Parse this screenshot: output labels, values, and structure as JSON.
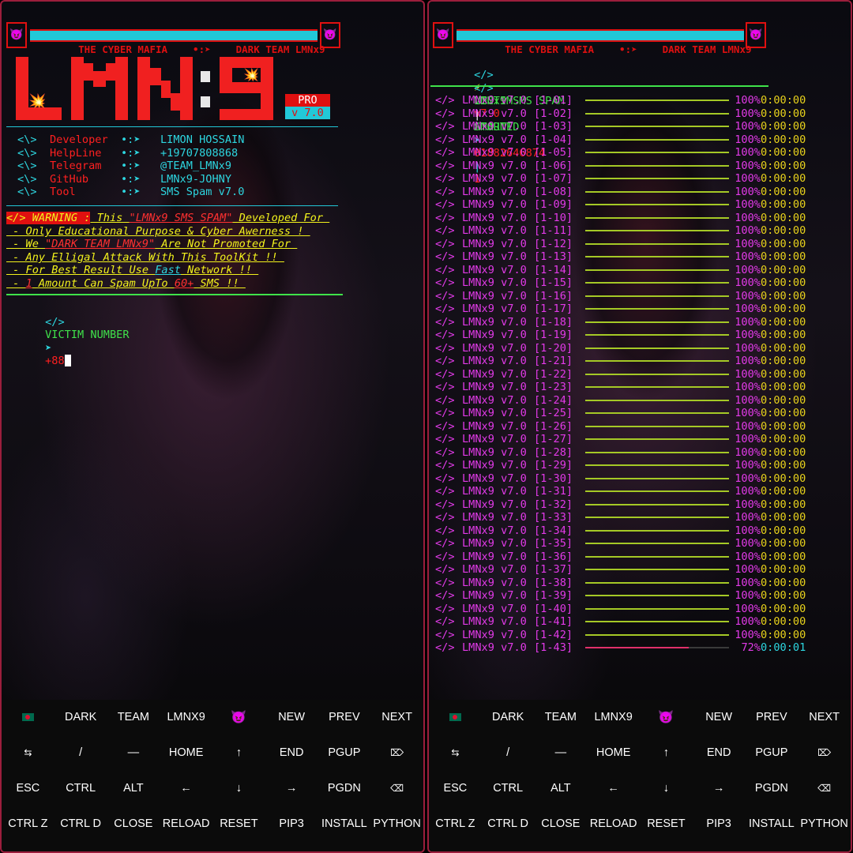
{
  "banner": {
    "left": "THE CYBER MAFIA",
    "arrow": "•:➤",
    "right": "DARK TEAM LMNx9",
    "icon": "😈"
  },
  "logo": {
    "text": "LMN:9",
    "pro": "PRO",
    "version": "v 7.0"
  },
  "info": [
    {
      "icon": "<\\>",
      "label": "Developer",
      "sep": "•:➤",
      "value": "LIMON HOSSAIN"
    },
    {
      "icon": "<\\>",
      "label": "HelpLine",
      "sep": "•:➤",
      "value": "+19707808868"
    },
    {
      "icon": "<\\>",
      "label": "Telegram",
      "sep": "•:➤",
      "value": "@TEAM_LMNx9"
    },
    {
      "icon": "<\\>",
      "label": "GitHub",
      "sep": "•:➤",
      "value": "LMNx9-JOHNY"
    },
    {
      "icon": "<\\>",
      "label": "Tool",
      "sep": "•:➤",
      "value": "SMS Spam v7.0"
    }
  ],
  "warning": {
    "tag": "</> WARNING :",
    "l1a": " This ",
    "l1b": "\"LMNx9 SMS SPAM\"",
    "l1c": " Developed For ",
    "l2": " - Only Educational Purpose & Cyber Awerness ! ",
    "l3a": " - We ",
    "l3b": "\"DARK TEAM LMNx9\"",
    "l3c": " Are Not Promoted For ",
    "l4": " - Any Elligal Attack With This ToolKit !! ",
    "l5a": " - For Best Result Use ",
    "l5b": "Fast",
    "l5c": " Network !! ",
    "l6a": " - ",
    "l6b": "1",
    "l6c": " Amount Can Spam UpTo ",
    "l6d": "60+",
    "l6e": " SMS !! "
  },
  "prompt": {
    "tag": "</>",
    "label": "VICTIM NUMBER",
    "arrow": "➤",
    "value": "+88"
  },
  "status": {
    "tag": "</>",
    "bolt": "⚡",
    "started_a": "LMNx9 SMS SPAM",
    "started_b": "v7.0",
    "started_c": "STARTED",
    "victim": "VICTIM",
    "pipe": "|",
    "amount": "AMOUNT",
    "arrow": "➤",
    "number": "01882646874",
    "count": "1"
  },
  "progress_rows": [
    {
      "tag": "</>",
      "name": "LMNx9 v7.0",
      "id": "[1-01]",
      "percent": "100%",
      "fill": 1.0,
      "time": "0:00:00"
    },
    {
      "tag": "</>",
      "name": "LMNx9 v7.0",
      "id": "[1-02]",
      "percent": "100%",
      "fill": 1.0,
      "time": "0:00:00"
    },
    {
      "tag": "</>",
      "name": "LMNx9 v7.0",
      "id": "[1-03]",
      "percent": "100%",
      "fill": 1.0,
      "time": "0:00:00"
    },
    {
      "tag": "</>",
      "name": "LMNx9 v7.0",
      "id": "[1-04]",
      "percent": "100%",
      "fill": 1.0,
      "time": "0:00:00"
    },
    {
      "tag": "</>",
      "name": "LMNx9 v7.0",
      "id": "[1-05]",
      "percent": "100%",
      "fill": 1.0,
      "time": "0:00:00"
    },
    {
      "tag": "</>",
      "name": "LMNx9 v7.0",
      "id": "[1-06]",
      "percent": "100%",
      "fill": 1.0,
      "time": "0:00:00"
    },
    {
      "tag": "</>",
      "name": "LMNx9 v7.0",
      "id": "[1-07]",
      "percent": "100%",
      "fill": 1.0,
      "time": "0:00:00"
    },
    {
      "tag": "</>",
      "name": "LMNx9 v7.0",
      "id": "[1-08]",
      "percent": "100%",
      "fill": 1.0,
      "time": "0:00:00"
    },
    {
      "tag": "</>",
      "name": "LMNx9 v7.0",
      "id": "[1-09]",
      "percent": "100%",
      "fill": 1.0,
      "time": "0:00:00"
    },
    {
      "tag": "</>",
      "name": "LMNx9 v7.0",
      "id": "[1-10]",
      "percent": "100%",
      "fill": 1.0,
      "time": "0:00:00"
    },
    {
      "tag": "</>",
      "name": "LMNx9 v7.0",
      "id": "[1-11]",
      "percent": "100%",
      "fill": 1.0,
      "time": "0:00:00"
    },
    {
      "tag": "</>",
      "name": "LMNx9 v7.0",
      "id": "[1-12]",
      "percent": "100%",
      "fill": 1.0,
      "time": "0:00:00"
    },
    {
      "tag": "</>",
      "name": "LMNx9 v7.0",
      "id": "[1-13]",
      "percent": "100%",
      "fill": 1.0,
      "time": "0:00:00"
    },
    {
      "tag": "</>",
      "name": "LMNx9 v7.0",
      "id": "[1-14]",
      "percent": "100%",
      "fill": 1.0,
      "time": "0:00:00"
    },
    {
      "tag": "</>",
      "name": "LMNx9 v7.0",
      "id": "[1-15]",
      "percent": "100%",
      "fill": 1.0,
      "time": "0:00:00"
    },
    {
      "tag": "</>",
      "name": "LMNx9 v7.0",
      "id": "[1-16]",
      "percent": "100%",
      "fill": 1.0,
      "time": "0:00:00"
    },
    {
      "tag": "</>",
      "name": "LMNx9 v7.0",
      "id": "[1-17]",
      "percent": "100%",
      "fill": 1.0,
      "time": "0:00:00"
    },
    {
      "tag": "</>",
      "name": "LMNx9 v7.0",
      "id": "[1-18]",
      "percent": "100%",
      "fill": 1.0,
      "time": "0:00:00"
    },
    {
      "tag": "</>",
      "name": "LMNx9 v7.0",
      "id": "[1-19]",
      "percent": "100%",
      "fill": 1.0,
      "time": "0:00:00"
    },
    {
      "tag": "</>",
      "name": "LMNx9 v7.0",
      "id": "[1-20]",
      "percent": "100%",
      "fill": 1.0,
      "time": "0:00:00"
    },
    {
      "tag": "</>",
      "name": "LMNx9 v7.0",
      "id": "[1-21]",
      "percent": "100%",
      "fill": 1.0,
      "time": "0:00:00"
    },
    {
      "tag": "</>",
      "name": "LMNx9 v7.0",
      "id": "[1-22]",
      "percent": "100%",
      "fill": 1.0,
      "time": "0:00:00"
    },
    {
      "tag": "</>",
      "name": "LMNx9 v7.0",
      "id": "[1-23]",
      "percent": "100%",
      "fill": 1.0,
      "time": "0:00:00"
    },
    {
      "tag": "</>",
      "name": "LMNx9 v7.0",
      "id": "[1-24]",
      "percent": "100%",
      "fill": 1.0,
      "time": "0:00:00"
    },
    {
      "tag": "</>",
      "name": "LMNx9 v7.0",
      "id": "[1-25]",
      "percent": "100%",
      "fill": 1.0,
      "time": "0:00:00"
    },
    {
      "tag": "</>",
      "name": "LMNx9 v7.0",
      "id": "[1-26]",
      "percent": "100%",
      "fill": 1.0,
      "time": "0:00:00"
    },
    {
      "tag": "</>",
      "name": "LMNx9 v7.0",
      "id": "[1-27]",
      "percent": "100%",
      "fill": 1.0,
      "time": "0:00:00"
    },
    {
      "tag": "</>",
      "name": "LMNx9 v7.0",
      "id": "[1-28]",
      "percent": "100%",
      "fill": 1.0,
      "time": "0:00:00"
    },
    {
      "tag": "</>",
      "name": "LMNx9 v7.0",
      "id": "[1-29]",
      "percent": "100%",
      "fill": 1.0,
      "time": "0:00:00"
    },
    {
      "tag": "</>",
      "name": "LMNx9 v7.0",
      "id": "[1-30]",
      "percent": "100%",
      "fill": 1.0,
      "time": "0:00:00"
    },
    {
      "tag": "</>",
      "name": "LMNx9 v7.0",
      "id": "[1-31]",
      "percent": "100%",
      "fill": 1.0,
      "time": "0:00:00"
    },
    {
      "tag": "</>",
      "name": "LMNx9 v7.0",
      "id": "[1-32]",
      "percent": "100%",
      "fill": 1.0,
      "time": "0:00:00"
    },
    {
      "tag": "</>",
      "name": "LMNx9 v7.0",
      "id": "[1-33]",
      "percent": "100%",
      "fill": 1.0,
      "time": "0:00:00"
    },
    {
      "tag": "</>",
      "name": "LMNx9 v7.0",
      "id": "[1-34]",
      "percent": "100%",
      "fill": 1.0,
      "time": "0:00:00"
    },
    {
      "tag": "</>",
      "name": "LMNx9 v7.0",
      "id": "[1-35]",
      "percent": "100%",
      "fill": 1.0,
      "time": "0:00:00"
    },
    {
      "tag": "</>",
      "name": "LMNx9 v7.0",
      "id": "[1-36]",
      "percent": "100%",
      "fill": 1.0,
      "time": "0:00:00"
    },
    {
      "tag": "</>",
      "name": "LMNx9 v7.0",
      "id": "[1-37]",
      "percent": "100%",
      "fill": 1.0,
      "time": "0:00:00"
    },
    {
      "tag": "</>",
      "name": "LMNx9 v7.0",
      "id": "[1-38]",
      "percent": "100%",
      "fill": 1.0,
      "time": "0:00:00"
    },
    {
      "tag": "</>",
      "name": "LMNx9 v7.0",
      "id": "[1-39]",
      "percent": "100%",
      "fill": 1.0,
      "time": "0:00:00"
    },
    {
      "tag": "</>",
      "name": "LMNx9 v7.0",
      "id": "[1-40]",
      "percent": "100%",
      "fill": 1.0,
      "time": "0:00:00"
    },
    {
      "tag": "</>",
      "name": "LMNx9 v7.0",
      "id": "[1-41]",
      "percent": "100%",
      "fill": 1.0,
      "time": "0:00:00"
    },
    {
      "tag": "</>",
      "name": "LMNx9 v7.0",
      "id": "[1-42]",
      "percent": "100%",
      "fill": 1.0,
      "time": "0:00:00"
    },
    {
      "tag": "</>",
      "name": "LMNx9 v7.0",
      "id": "[1-43]",
      "percent": "72%",
      "fill": 0.72,
      "time": "0:00:01"
    }
  ],
  "keyboard": [
    [
      {
        "label": "",
        "icon": "bangladesh-flag-icon"
      },
      {
        "label": "DARK"
      },
      {
        "label": "TEAM"
      },
      {
        "label": "LMNX9"
      },
      {
        "label": "😈",
        "icon": "devil-icon"
      },
      {
        "label": "NEW"
      },
      {
        "label": "PREV"
      },
      {
        "label": "NEXT"
      }
    ],
    [
      {
        "label": "⇆",
        "icon": "tab-icon"
      },
      {
        "label": "/"
      },
      {
        "label": "—"
      },
      {
        "label": "HOME"
      },
      {
        "label": "↑",
        "icon": "arrow-up-icon"
      },
      {
        "label": "END"
      },
      {
        "label": "PGUP"
      },
      {
        "label": "⌦",
        "icon": "delete-icon"
      }
    ],
    [
      {
        "label": "ESC"
      },
      {
        "label": "CTRL"
      },
      {
        "label": "ALT"
      },
      {
        "label": "←",
        "icon": "arrow-left-icon"
      },
      {
        "label": "↓",
        "icon": "arrow-down-icon"
      },
      {
        "label": "→",
        "icon": "arrow-right-icon"
      },
      {
        "label": "PGDN"
      },
      {
        "label": "⌫",
        "icon": "backspace-icon"
      }
    ],
    [
      {
        "label": "CTRL Z"
      },
      {
        "label": "CTRL D"
      },
      {
        "label": "CLOSE"
      },
      {
        "label": "RELOAD"
      },
      {
        "label": "RESET"
      },
      {
        "label": "PIP3"
      },
      {
        "label": "INSTALL"
      },
      {
        "label": "PYTHON"
      }
    ]
  ],
  "colors": {
    "accent_red": "#e01010",
    "accent_cyan": "#22c8d8",
    "green": "#3fe24a",
    "magenta": "#e23ae8",
    "yellow": "#f2f21c",
    "bar": "#a5c826"
  }
}
